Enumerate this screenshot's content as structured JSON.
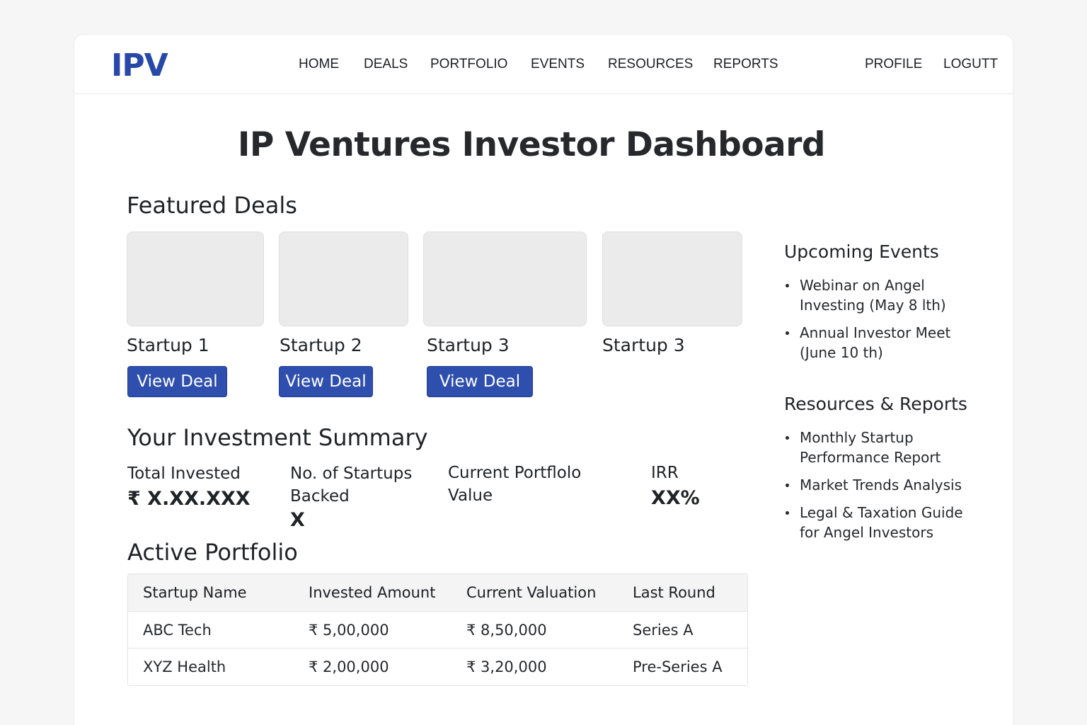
{
  "brand": {
    "logo": "IPV",
    "accent": "#2748a8",
    "button_color": "#2e4fad"
  },
  "nav": {
    "items": [
      "HOME",
      "DEALS",
      "PORTFOLIO",
      "EVENTS",
      "RESOURCES",
      "REPORTS"
    ],
    "right": [
      "PROFILE",
      "LOGUTT"
    ]
  },
  "page_title": "IP Ventures Investor Dashboard",
  "featured": {
    "title": "Featured Deals",
    "deals": [
      {
        "name": "Startup 1",
        "button": "View Deal"
      },
      {
        "name": "Startup 2",
        "button": "View Deal"
      },
      {
        "name": "Startup 3",
        "button": "View Deal"
      },
      {
        "name": "Startup 3"
      }
    ]
  },
  "summary": {
    "title": "Your Investment Summary",
    "total_label": "Total Invested",
    "total_value": "₹ X.XX.XXX",
    "startups_label_1": "No. of Startups",
    "startups_label_2": "Backed",
    "startups_value": "X",
    "portfolio_label_1": "Current Portflolo",
    "portfolio_label_2": "Value",
    "irr_label": "IRR",
    "irr_value": "XX%"
  },
  "portfolio": {
    "title": "Active Portfolio",
    "headers": [
      "Startup Name",
      "Invested Amount",
      "Current Valuation",
      "Last Round"
    ],
    "rows": [
      [
        "ABC Tech",
        "₹ 5,00,000",
        "₹ 8,50,000",
        "Series A"
      ],
      [
        "XYZ Health",
        "₹ 2,00,000",
        "₹ 3,20,000",
        "Pre-Series A"
      ]
    ]
  },
  "events": {
    "title": "Upcoming Events",
    "items": [
      {
        "line1": "Webinar on Angel",
        "line2": "Investing (May 8 lth)"
      },
      {
        "line1": "Annual Investor Meet",
        "line2": "(June 10 th)"
      }
    ]
  },
  "resources": {
    "title": "Resources & Reports",
    "items": [
      {
        "line1": "Monthly Startup",
        "line2": "Performance Report"
      },
      {
        "line1": "Market Trends Analysis",
        "line2": ""
      },
      {
        "line1": "Legal & Taxation Guide",
        "line2": "for Angel Investors"
      }
    ]
  }
}
